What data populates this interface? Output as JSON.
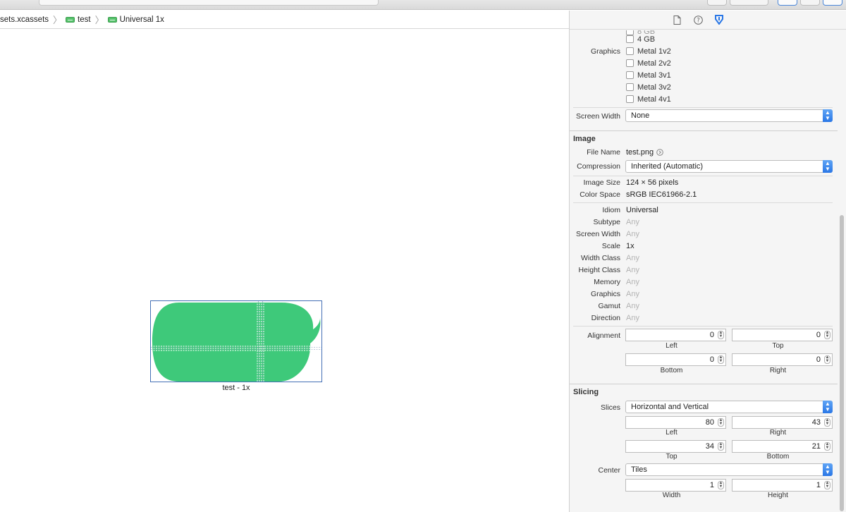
{
  "jumpbar": {
    "crumbs": [
      "sets.xcassets",
      "test",
      "Universal 1x"
    ]
  },
  "canvas": {
    "image_caption": "test - 1x",
    "image_color": "#3ec97a"
  },
  "inspector": {
    "memory_options": [
      "4 GB"
    ],
    "graphics_label": "Graphics",
    "graphics_options": [
      "Metal 1v2",
      "Metal 2v2",
      "Metal 3v1",
      "Metal 3v2",
      "Metal 4v1"
    ],
    "screen_width_label": "Screen Width",
    "screen_width_value": "None",
    "image_section": {
      "title": "Image",
      "file_name_label": "File Name",
      "file_name": "test.png",
      "compression_label": "Compression",
      "compression_value": "Inherited (Automatic)",
      "image_size_label": "Image Size",
      "image_size": "124 × 56 pixels",
      "color_space_label": "Color Space",
      "color_space": "sRGB IEC61966-2.1"
    },
    "traits": [
      {
        "label": "Idiom",
        "value": "Universal",
        "dim": false
      },
      {
        "label": "Subtype",
        "value": "Any",
        "dim": true
      },
      {
        "label": "Screen Width",
        "value": "Any",
        "dim": true
      },
      {
        "label": "Scale",
        "value": "1x",
        "dim": false
      },
      {
        "label": "Width Class",
        "value": "Any",
        "dim": true
      },
      {
        "label": "Height Class",
        "value": "Any",
        "dim": true
      },
      {
        "label": "Memory",
        "value": "Any",
        "dim": true
      },
      {
        "label": "Graphics",
        "value": "Any",
        "dim": true
      },
      {
        "label": "Gamut",
        "value": "Any",
        "dim": true
      },
      {
        "label": "Direction",
        "value": "Any",
        "dim": true
      }
    ],
    "alignment": {
      "label": "Alignment",
      "left": "0",
      "left_label": "Left",
      "top": "0",
      "top_label": "Top",
      "bottom": "0",
      "bottom_label": "Bottom",
      "right": "0",
      "right_label": "Right"
    },
    "slicing": {
      "title": "Slicing",
      "slices_label": "Slices",
      "slices_value": "Horizontal and Vertical",
      "left": "80",
      "left_label": "Left",
      "right": "43",
      "right_label": "Right",
      "top": "34",
      "top_label": "Top",
      "bottom": "21",
      "bottom_label": "Bottom",
      "center_label": "Center",
      "center_value": "Tiles",
      "width": "1",
      "width_label": "Width",
      "height": "1",
      "height_label": "Height"
    },
    "accent_color": "#2a77e6"
  }
}
